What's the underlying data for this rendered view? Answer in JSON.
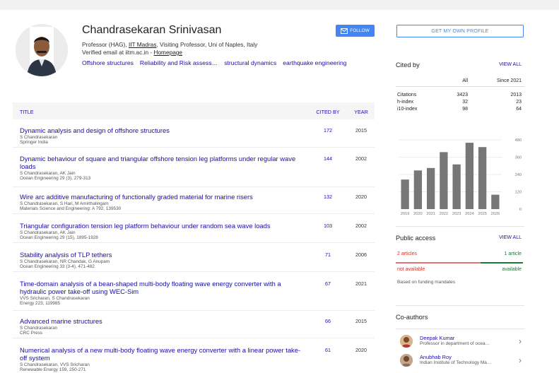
{
  "profile": {
    "name": "Chandrasekaran Srinivasan",
    "affil_prefix": "Professor (HAG), ",
    "affil_link": "IIT Madras",
    "affil_suffix": ", Visiting Professor, Uni of Naples, Italy",
    "email_prefix": "Verified email at iitm.ac.in - ",
    "email_link": "Homepage",
    "interests": [
      "Offshore structures",
      "Reliability and Risk assess…",
      "structural dynamics",
      "earthquake engineering"
    ],
    "follow_label": "FOLLOW"
  },
  "table": {
    "col_title": "TITLE",
    "col_cited": "CITED BY",
    "col_year": "YEAR",
    "rows": [
      {
        "title": "Dynamic analysis and design of offshore structures",
        "authors": "S Chandrasekaran",
        "venue": "Springer India",
        "cited": "172",
        "year": "2015"
      },
      {
        "title": "Dynamic behaviour of square and triangular offshore tension leg platforms under regular wave loads",
        "authors": "S Chandrasekaran, AK Jain",
        "venue": "Ocean Engineering 29 (3), 279-313",
        "cited": "144",
        "year": "2002"
      },
      {
        "title": "Wire arc additive manufacturing of functionally graded material for marine risers",
        "authors": "S Chandrasekaran, S Hari, M Amirthalingam",
        "venue": "Materials Science and Engineering: A 792, 139530",
        "cited": "132",
        "year": "2020"
      },
      {
        "title": "Triangular configuration tension leg platform behaviour under random sea wave loads",
        "authors": "S Chandrasekaran, AK Jain",
        "venue": "Ocean Engineering 29 (15), 1895-1928",
        "cited": "103",
        "year": "2002"
      },
      {
        "title": "Stability analysis of TLP tethers",
        "authors": "S Chandrasekaran, NR Chandak, G Anupam",
        "venue": "Ocean Engineering 33 (3-4), 471-482",
        "cited": "71",
        "year": "2006"
      },
      {
        "title": "Time-domain analysis of a bean-shaped multi-body floating wave energy converter with a hydraulic power take-off using WEC-Sim",
        "authors": "VVS Sricharan, S Chandrasekaran",
        "venue": "Energy 223, 119985",
        "cited": "67",
        "year": "2021"
      },
      {
        "title": "Advanced marine structures",
        "authors": "S Chandrasekaran",
        "venue": "CRC Press",
        "cited": "66",
        "year": "2015"
      },
      {
        "title": "Numerical analysis of a new multi-body floating wave energy converter with a linear power take-off system",
        "authors": "S Chandrasekaran, VVS Sricharan",
        "venue": "Renewable Energy 159, 250-271",
        "cited": "61",
        "year": "2020"
      }
    ]
  },
  "sidebar": {
    "own_profile_label": "GET MY OWN PROFILE",
    "cited_by": {
      "title": "Cited by",
      "view_all": "VIEW ALL",
      "col_all": "All",
      "col_since": "Since 2021",
      "rows": [
        {
          "label": "Citations",
          "all": "3423",
          "since": "2013"
        },
        {
          "label": "h-index",
          "all": "32",
          "since": "23"
        },
        {
          "label": "i10-index",
          "all": "98",
          "since": "64"
        }
      ]
    },
    "public_access": {
      "title": "Public access",
      "view_all": "VIEW ALL",
      "left_count": "2 articles",
      "right_count": "1 article",
      "left_label": "not available",
      "right_label": "available",
      "note": "Based on funding mandates"
    },
    "coauthors": {
      "title": "Co-authors",
      "items": [
        {
          "name": "Deepak Kumar",
          "affil": "Professor in department of ocea…"
        },
        {
          "name": "Anubhab Roy",
          "affil": "Indian Institute of Technology Ma…"
        }
      ]
    }
  },
  "chart_data": {
    "type": "bar",
    "categories": [
      "2019",
      "2020",
      "2021",
      "2022",
      "2023",
      "2024",
      "2025",
      "2026"
    ],
    "values": [
      205,
      268,
      285,
      395,
      310,
      460,
      430,
      100
    ],
    "yticks": [
      0,
      120,
      240,
      360,
      480
    ],
    "ylim": [
      0,
      480
    ],
    "bar_color": "#777777"
  },
  "colors": {
    "link": "#1a0dab",
    "accent": "#4285f4"
  }
}
